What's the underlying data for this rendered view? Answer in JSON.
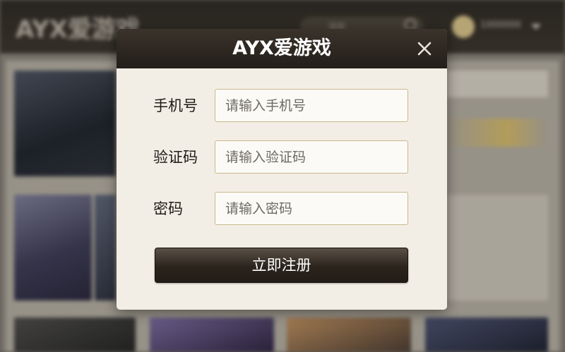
{
  "background": {
    "logo": "AYX爱游戏",
    "search_placeholder": "搜索",
    "coins": "1000000",
    "icons": [
      "search-icon",
      "avatar-icon",
      "caret-down-icon"
    ]
  },
  "modal": {
    "title": "AYX爱游戏",
    "close_icon": "close-icon",
    "fields": {
      "phone": {
        "label": "手机号",
        "placeholder": "请输入手机号"
      },
      "code": {
        "label": "验证码",
        "placeholder": "请输入验证码"
      },
      "password": {
        "label": "密码",
        "placeholder": "请输入密码"
      }
    },
    "submit_label": "立即注册"
  },
  "colors": {
    "header_bg": "#2b251f",
    "modal_bg": "#f3eee5",
    "input_border": "#cbb98f",
    "button_bg": "#2b241d",
    "button_text": "#ffffff"
  }
}
